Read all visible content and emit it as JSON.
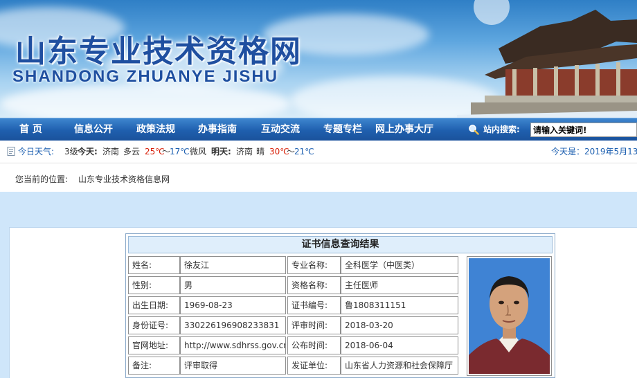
{
  "site": {
    "title_cn": "山东专业技术资格网",
    "title_en": "SHANDONG ZHUANYE JISHU"
  },
  "nav": {
    "items": [
      "首 页",
      "信息公开",
      "政策法规",
      "办事指南",
      "互动交流",
      "专题专栏",
      "网上办事大厅"
    ],
    "search_label": "站内搜索:",
    "search_value": "请输入关键词!"
  },
  "weather": {
    "today_label": "今日天气:",
    "wind_level": "3级",
    "today_tag": "今天:",
    "city": "济南",
    "today_condition": "多云",
    "today_high": "25℃",
    "tilde1": "～",
    "today_low": "17℃",
    "wind_dir": "微风",
    "tomorrow_tag": "明天:",
    "city2": "济南",
    "tomorrow_condition": "晴",
    "tomorrow_high": "30℃",
    "tilde2": "～",
    "tomorrow_low": "21℃",
    "date_text": "今天是：2019年5月13"
  },
  "breadcrumb": {
    "label": "您当前的位置:",
    "location": "山东专业技术资格信息网"
  },
  "result": {
    "title": "证书信息查询结果",
    "rows": [
      {
        "label1": "姓名:",
        "value1": "徐友江",
        "label2": "专业名称:",
        "value2": "全科医学（中医类）"
      },
      {
        "label1": "性别:",
        "value1": "男",
        "label2": "资格名称:",
        "value2": "主任医师"
      },
      {
        "label1": "出生日期:",
        "value1": "1969-08-23",
        "label2": "证书编号:",
        "value2": "鲁1808311151"
      },
      {
        "label1": "身份证号:",
        "value1": "330226196908233831",
        "label2": "评审时间:",
        "value2": "2018-03-20"
      },
      {
        "label1": "官网地址:",
        "value1": "http://www.sdhrss.gov.cn/",
        "label2": "公布时间:",
        "value2": "2018-06-04"
      },
      {
        "label1": "备注:",
        "value1": "评审取得",
        "label2": "发证单位:",
        "value2": "山东省人力资源和社会保障厅"
      }
    ]
  },
  "colors": {
    "nav_bg": "#1f5fae",
    "weather_blue": "#1c5fb0",
    "weather_red": "#d81e06",
    "page_bg": "#cfe6fa"
  }
}
